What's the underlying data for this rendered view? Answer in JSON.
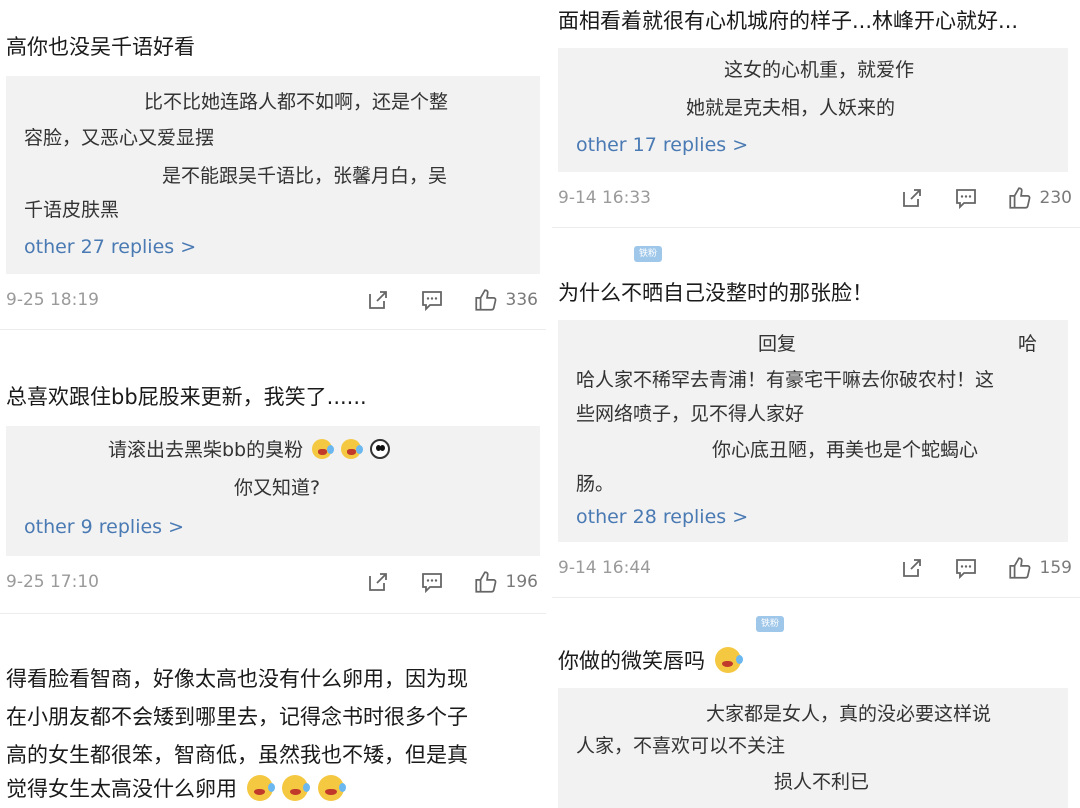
{
  "colors": {
    "background": "#ffffff",
    "reply_box": "#f2f2f2",
    "link": "#4a7ab3",
    "meta": "#9a9a9a",
    "badge": "#9fc7ea"
  },
  "left": {
    "comments": [
      {
        "text": "高你也没吴千语好看",
        "replies": [
          "比不比她连路人都不如啊，还是个整",
          "容脸，又恶心又爱显摆",
          "是不能跟吴千语比，张馨月白，吴",
          "千语皮肤黑"
        ],
        "more": "other 27 replies >",
        "time": "9-25 18:19",
        "likes": "336"
      },
      {
        "text": "总喜欢跟住bb屁股来更新，我笑了......",
        "replies": [
          "请滚出去黑柴bb的臭粉",
          "你又知道?"
        ],
        "more": "other 9 replies >",
        "time": "9-25 17:10",
        "likes": "196"
      },
      {
        "lines": [
          "得看脸看智商，好像太高也没有什么卵用，因为现",
          "在小朋友都不会矮到哪里去，记得念书时很多个子",
          "高的女生都很笨，智商低，虽然我也不矮，但是真",
          "觉得女生太高没什么卵用"
        ]
      }
    ]
  },
  "right": {
    "comments": [
      {
        "text": "面相看着就很有心机城府的样子...林峰开心就好...",
        "replies": [
          "这女的心机重，就爱作",
          "她就是克夫相，人妖来的"
        ],
        "more": "other 17 replies >",
        "time": "9-14 16:33",
        "likes": "230"
      },
      {
        "badge": "铁粉",
        "text": "为什么不晒自己没整时的那张脸！",
        "reply_prefix": "回复",
        "reply_suffix": "哈",
        "replies": [
          "哈人家不稀罕去青浦！有豪宅干嘛去你破农村！这",
          "些网络喷子，见不得人家好",
          "你心底丑陋，再美也是个蛇蝎心",
          "肠。"
        ],
        "more": "other 28 replies >",
        "time": "9-14 16:44",
        "likes": "159"
      },
      {
        "badge": "铁粉",
        "text": "你做的微笑唇吗",
        "replies": [
          "大家都是女人，真的没必要这样说",
          "人家，不喜欢可以不关注",
          "损人不利已"
        ]
      }
    ]
  }
}
